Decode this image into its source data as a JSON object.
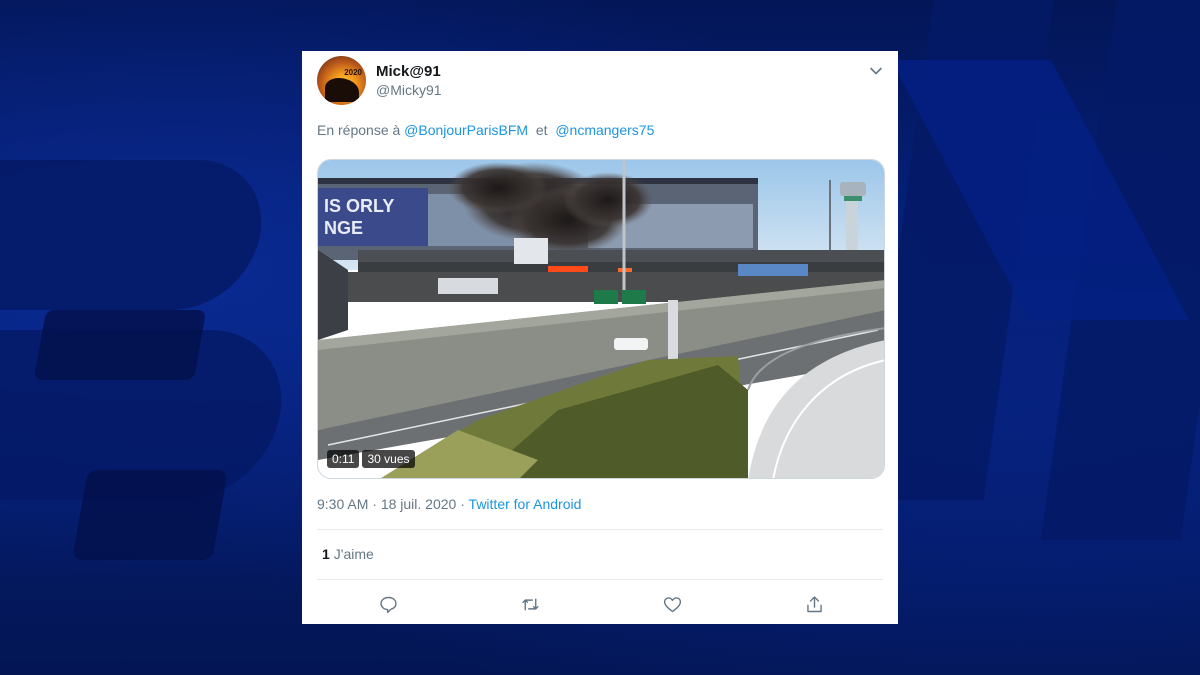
{
  "tweet": {
    "display_name": "Mick@91",
    "handle": "@Micky91",
    "avatar_text": "2020",
    "reply": {
      "prefix": "En réponse à ",
      "mention_1": "@BonjourParisBFM",
      "joiner": "  et  ",
      "mention_2": "@ncmangers75"
    },
    "media": {
      "duration": "0:11",
      "views": "30 vues",
      "sign_text": "IS ORLY",
      "sign_text_2": "NGE"
    },
    "time": "9:30 AM",
    "separator": " · ",
    "date": "18 juil. 2020",
    "source": "Twitter for Android",
    "likes_count": "1",
    "likes_label": "J'aime"
  },
  "actions": {
    "reply_icon": "comment-icon",
    "retweet_icon": "retweet-icon",
    "like_icon": "heart-icon",
    "share_icon": "share-icon"
  },
  "colors": {
    "background": "#041a6b",
    "link": "#1b95e0",
    "muted_text": "#657786",
    "primary_text": "#14171a",
    "smoke": "#2b2624",
    "fire": "#ff4a1a"
  }
}
